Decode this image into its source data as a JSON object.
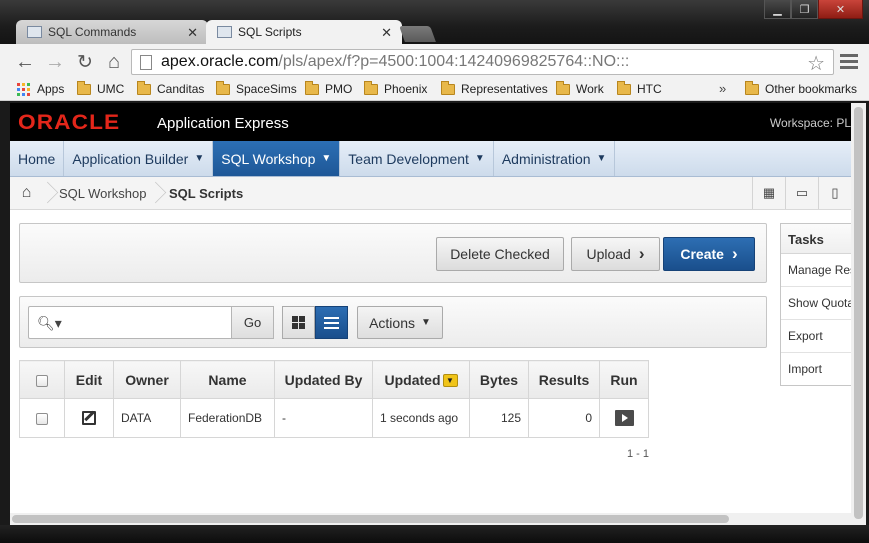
{
  "browser": {
    "tabs": [
      {
        "label": "SQL Commands",
        "active": false
      },
      {
        "label": "SQL Scripts",
        "active": true
      }
    ],
    "url_host": "apex.oracle.com",
    "url_path": "/pls/apex/f?p=4500:1004:14240969825764::NO:::",
    "bookmarks": [
      "Apps",
      "UMC",
      "Canditas",
      "SpaceSims",
      "PMO",
      "Phoenix",
      "Representatives",
      "Work",
      "HTC"
    ],
    "bookmarks_overflow": "»",
    "other_bookmarks": "Other bookmarks"
  },
  "apex": {
    "logo": "ORACLE",
    "product": "Application Express",
    "workspace": "Workspace: PL"
  },
  "nav": [
    {
      "label": "Home",
      "dropdown": false,
      "active": false
    },
    {
      "label": "Application Builder",
      "dropdown": true,
      "active": false
    },
    {
      "label": "SQL Workshop",
      "dropdown": true,
      "active": true
    },
    {
      "label": "Team Development",
      "dropdown": true,
      "active": false
    },
    {
      "label": "Administration",
      "dropdown": true,
      "active": false
    }
  ],
  "breadcrumb": {
    "parent": "SQL Workshop",
    "current": "SQL Scripts"
  },
  "buttons": {
    "delete": "Delete Checked",
    "upload": "Upload",
    "create": "Create"
  },
  "search": {
    "placeholder": "",
    "go": "Go",
    "actions": "Actions"
  },
  "table": {
    "columns": [
      "Edit",
      "Owner",
      "Name",
      "Updated By",
      "Updated",
      "Bytes",
      "Results",
      "Run"
    ],
    "rows": [
      {
        "owner": "DATA",
        "name": "FederationDB",
        "updated_by": "-",
        "updated": "1 seconds ago",
        "bytes": "125",
        "results": "0"
      }
    ],
    "pagination": "1 - 1"
  },
  "tasks": {
    "title": "Tasks",
    "links": [
      "Manage Result",
      "Show Quotas",
      "Export",
      "Import"
    ]
  },
  "colors": {
    "oracle_red": "#e3261a",
    "apex_blue": "#1e5797",
    "sort_yellow": "#f0c419"
  }
}
